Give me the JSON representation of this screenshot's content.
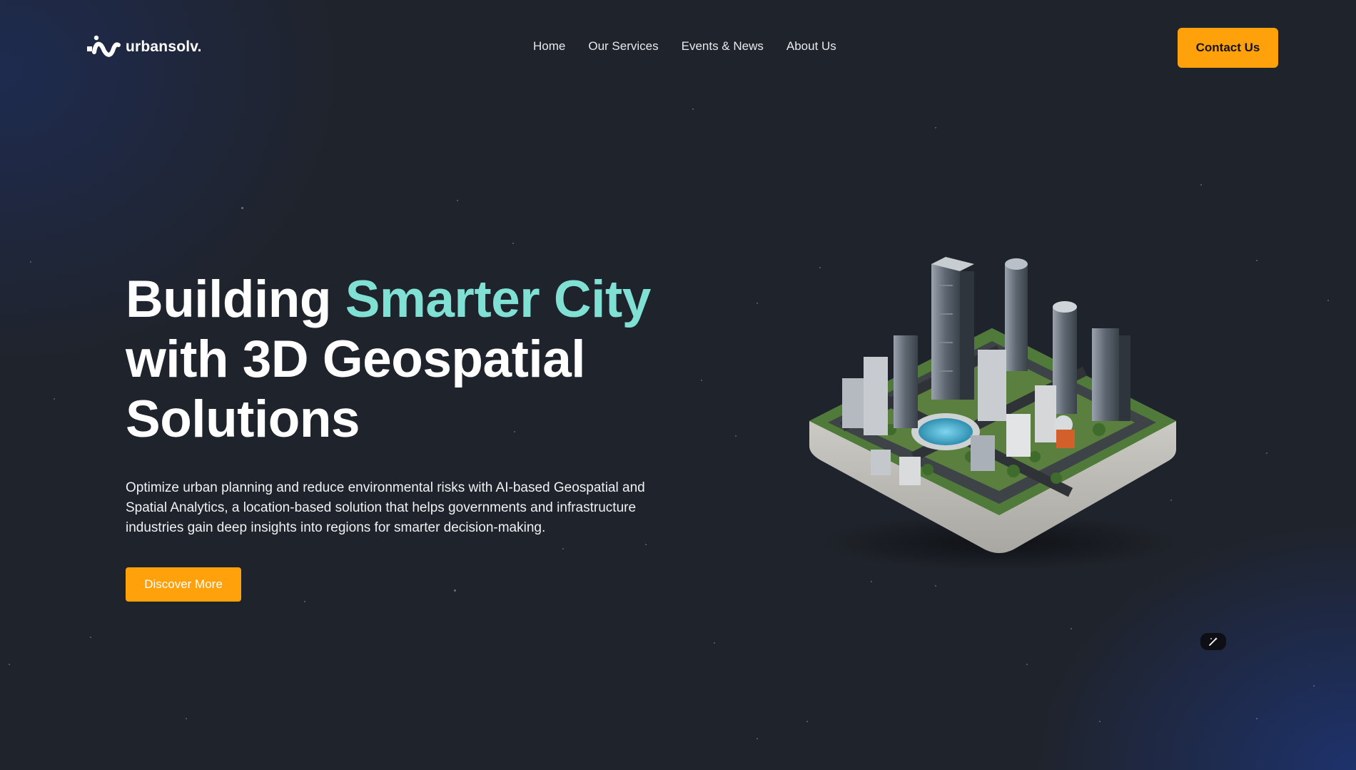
{
  "brand": {
    "name": "urbansolv.",
    "logo_icon": "urbansolv-logo-icon"
  },
  "nav": {
    "items": [
      {
        "label": "Home"
      },
      {
        "label": "Our Services"
      },
      {
        "label": "Events & News"
      },
      {
        "label": "About Us"
      }
    ],
    "cta_label": "Contact Us"
  },
  "hero": {
    "title_part1": "Building ",
    "title_accent": "Smarter City",
    "title_line2": "with 3D Geospatial",
    "title_line3": "Solutions",
    "description": "Optimize urban planning and reduce environmental risks with AI-based Geospatial and Spatial Analytics, a location-based solution that helps governments and infrastructure industries gain deep insights into regions for smarter decision-making.",
    "button_label": "Discover More"
  },
  "colors": {
    "background": "#1f232b",
    "accent_teal": "#7fe0d3",
    "cta_orange": "#ffa10a"
  },
  "floating_widget": {
    "icon": "magic-wand-icon"
  }
}
